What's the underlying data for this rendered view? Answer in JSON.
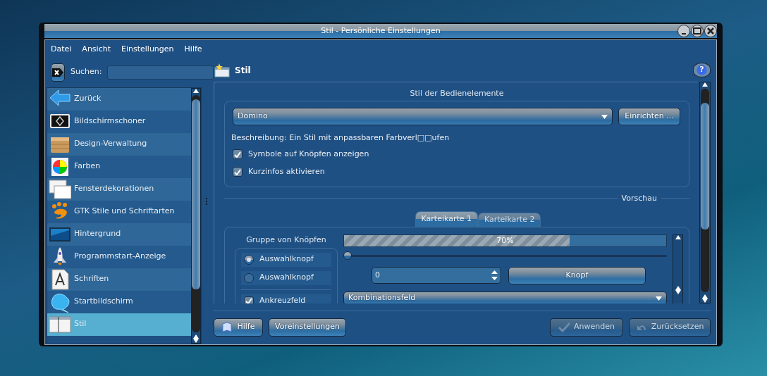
{
  "window": {
    "title": "Stil - Persönliche Einstellungen"
  },
  "menu": [
    {
      "label": "Datei"
    },
    {
      "label": "Ansicht"
    },
    {
      "label": "Einstellungen"
    },
    {
      "label": "Hilfe"
    }
  ],
  "search": {
    "label": "Suchen:"
  },
  "sidebar": {
    "items": [
      {
        "label": "Zurück",
        "selected": false
      },
      {
        "label": "Bildschirmschoner",
        "selected": false
      },
      {
        "label": "Design-Verwaltung",
        "selected": false
      },
      {
        "label": "Farben",
        "selected": false
      },
      {
        "label": "Fensterdekorationen",
        "selected": false
      },
      {
        "label": "GTK Stile und Schriftarten",
        "selected": false
      },
      {
        "label": "Hintergrund",
        "selected": false
      },
      {
        "label": "Programmstart-Anzeige",
        "selected": false
      },
      {
        "label": "Schriften",
        "selected": false
      },
      {
        "label": "Startbildschirm",
        "selected": false
      },
      {
        "label": "Stil",
        "selected": true
      }
    ]
  },
  "header": {
    "title": "Stil",
    "help_button": "?"
  },
  "style_group": {
    "title": "Stil der Bedienelemente",
    "combo_value": "Domino",
    "configure_button": "Einrichten ...",
    "description": "Beschreibung: Ein Stil mit anpassbaren Farbverl□□ufen",
    "checkboxes": [
      {
        "label": "Symbole auf Knöpfen anzeigen",
        "checked": true
      },
      {
        "label": "Kurzinfos aktivieren",
        "checked": true
      }
    ]
  },
  "preview": {
    "title": "Vorschau",
    "tabs": [
      {
        "label": "Karteikarte 1",
        "selected": true
      },
      {
        "label": "Karteikarte 2",
        "selected": false
      }
    ],
    "button_group": {
      "title": "Gruppe von Knöpfen",
      "items": [
        {
          "kind": "radio",
          "label": "Auswahlknopf",
          "checked": true
        },
        {
          "kind": "radio",
          "label": "Auswahlknopf",
          "checked": false
        },
        {
          "kind": "checkbox",
          "label": "Ankreuzfeld",
          "checked": true
        }
      ]
    },
    "progress": {
      "level": 0.7,
      "reading": "70%"
    },
    "slider": {
      "level": 0
    },
    "spinbox": {
      "value": "0"
    },
    "button": "Knopf",
    "combo": "Kombinationsfeld"
  },
  "buttons": [
    {
      "label": "Hilfe",
      "disabled": false
    },
    {
      "label": "Voreinstellungen",
      "disabled": false
    },
    {
      "label": "Anwenden",
      "disabled": true
    },
    {
      "label": "Zurücksetzen",
      "disabled": true
    }
  ]
}
